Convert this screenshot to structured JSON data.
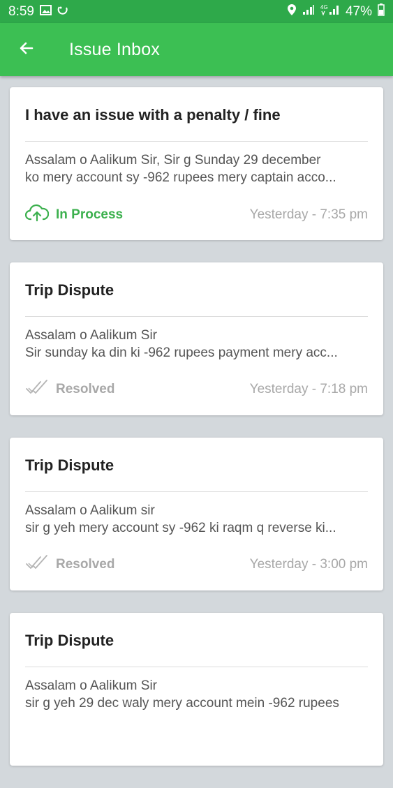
{
  "status_bar": {
    "time": "8:59",
    "battery": "47%"
  },
  "header": {
    "title": "Issue Inbox"
  },
  "issues": [
    {
      "title": "I have an issue with a penalty / fine",
      "line1": "Assalam o Aalikum Sir,  Sir g Sunday 29 december",
      "line2": "ko mery account sy -962 rupees mery captain acco...",
      "status": "In Process",
      "status_type": "process",
      "time": "Yesterday - 7:35 pm"
    },
    {
      "title": "Trip Dispute",
      "line1": "Assalam o Aalikum Sir",
      "line2": "Sir sunday ka din ki -962 rupees payment mery acc...",
      "status": "Resolved",
      "status_type": "resolved",
      "time": "Yesterday - 7:18 pm"
    },
    {
      "title": "Trip Dispute",
      "line1": "Assalam o Aalikum sir",
      "line2": "sir g yeh mery account sy -962 ki raqm q reverse ki...",
      "status": "Resolved",
      "status_type": "resolved",
      "time": "Yesterday - 3:00 pm"
    },
    {
      "title": "Trip Dispute",
      "line1": "Assalam o Aalikum Sir",
      "line2": "sir g yeh 29 dec waly mery account mein -962 rupees",
      "status": "",
      "status_type": "none",
      "time": ""
    }
  ],
  "colors": {
    "accent": "#3cbf53",
    "status_bar": "#2ea94a",
    "in_process": "#3cb04e"
  },
  "icons": {
    "back": "arrow-left-icon",
    "in_process": "cloud-upload-icon",
    "resolved": "double-check-icon"
  }
}
